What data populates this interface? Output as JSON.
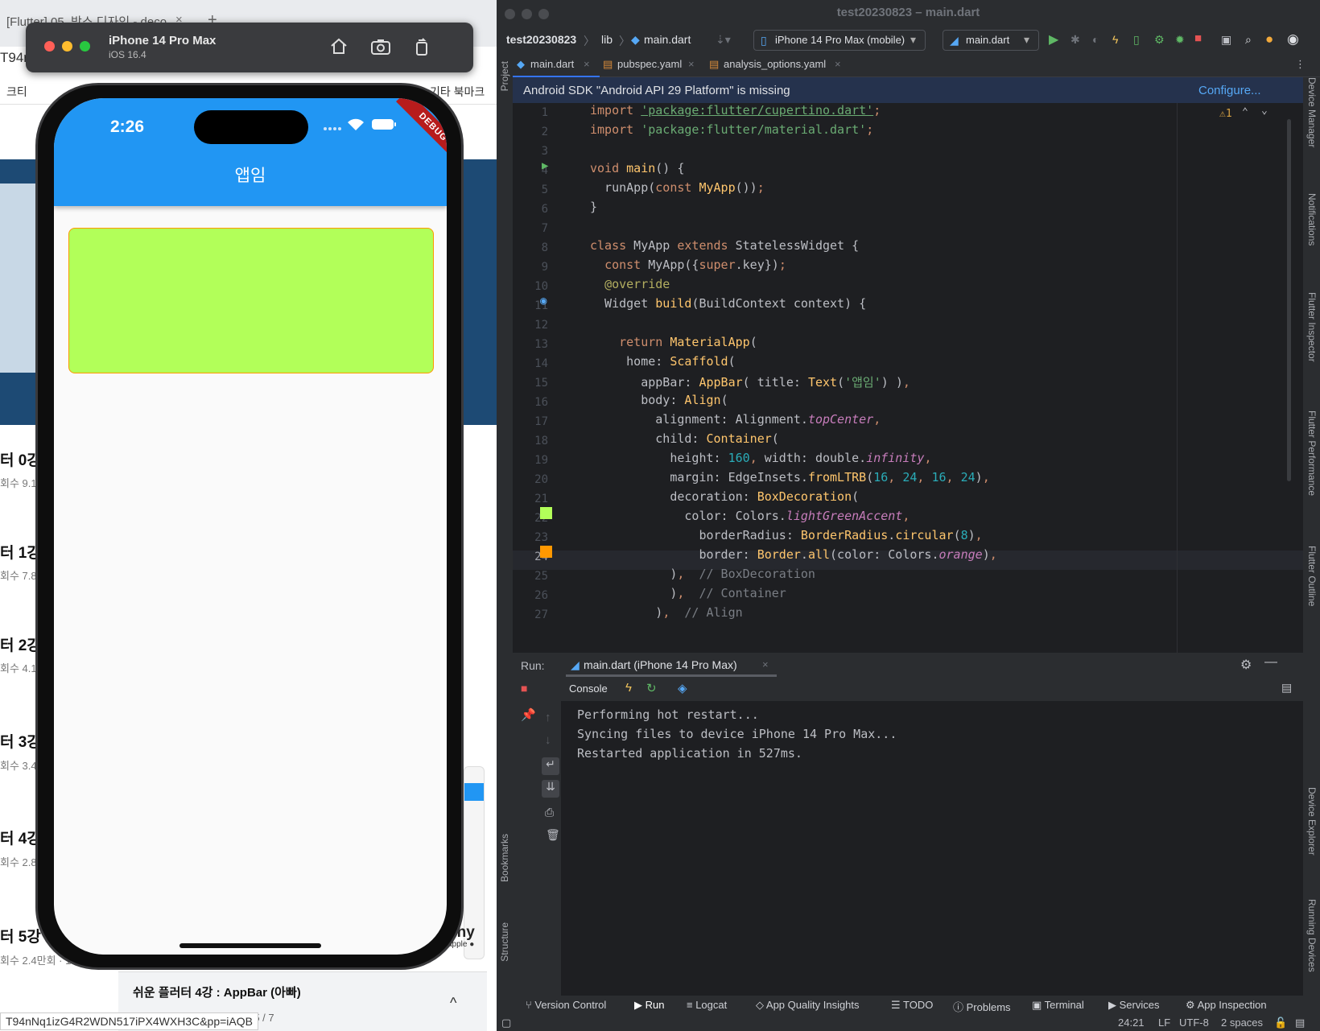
{
  "browser": {
    "tab_title": "[Flutter] 05. 박스 디자인 - deco...",
    "tab_close": "×",
    "new_tab": "+",
    "url_fragment": "T94r",
    "bookmark_left": "크티",
    "bookmark_right": "기타 북마크",
    "lessons": [
      {
        "title": "터 0강",
        "meta": "회수 9.1"
      },
      {
        "title": "터 1강",
        "meta": "회수 7.8"
      },
      {
        "title": "터 2강",
        "meta": "회수 4.1"
      },
      {
        "title": "터 3강",
        "meta": "회수 3.4"
      },
      {
        "title": "터 4강",
        "meta": "회수 2.8"
      },
      {
        "title": "터 5강 : ",
        "meta": "회수 2.4만회 · 1"
      }
    ],
    "side_text": "phy",
    "side_subtext": "apple ●",
    "queue_title": "쉬운 플러터 4강 : AppBar (아빠)",
    "queue_sub": "쉬게알려주는 플러터 강의 · 5 / 7",
    "queue_chevron": "^",
    "status_url": "T94nNq1izG4R2WDN517iPX4WXH3C&pp=iAQB"
  },
  "simulator": {
    "device_name": "iPhone 14 Pro Max",
    "os_version": "iOS 16.4",
    "status_time": "2:26",
    "app_title": "앱임",
    "debug_banner": "DEBUG",
    "container_color": "#b2ff59",
    "border_color": "#ff9800",
    "appbar_color": "#2196f3"
  },
  "ide": {
    "window_title": "test20230823 – main.dart",
    "project": "test20230823",
    "breadcrumb_lib": "lib",
    "breadcrumb_file": "main.dart",
    "device_selector": "iPhone 14 Pro Max (mobile)",
    "run_config": "main.dart",
    "tabs": [
      "main.dart",
      "pubspec.yaml",
      "analysis_options.yaml"
    ],
    "banner_message": "Android SDK \"Android API 29 Platform\" is missing",
    "banner_action": "Configure...",
    "warning_count": "⚠1",
    "line_numbers": [
      "1",
      "2",
      "3",
      "4",
      "5",
      "6",
      "7",
      "8",
      "9",
      "10",
      "11",
      "12",
      "13",
      "14",
      "15",
      "16",
      "17",
      "18",
      "19",
      "20",
      "21",
      "22",
      "23",
      "24",
      "25",
      "26",
      "27"
    ],
    "run_label": "Run:",
    "run_tab": "main.dart (iPhone 14 Pro Max)",
    "console_tab": "Console",
    "console_lines": [
      "Performing hot restart...",
      "Syncing files to device iPhone 14 Pro Max...",
      "Restarted application in 527ms."
    ],
    "bottom_tools": [
      "Version Control",
      "Run",
      "Logcat",
      "App Quality Insights",
      "TODO",
      "Problems",
      "Terminal",
      "Services",
      "App Inspection"
    ],
    "left_tools": [
      "Project",
      "Bookmarks",
      "Structure"
    ],
    "right_tools": [
      "Device Manager",
      "Notifications",
      "Flutter Inspector",
      "Flutter Performance",
      "Flutter Outline",
      "Device Explorer",
      "Running Devices"
    ],
    "status_position": "24:21",
    "status_lf": "LF",
    "status_encoding": "UTF-8",
    "status_indent": "2 spaces"
  }
}
